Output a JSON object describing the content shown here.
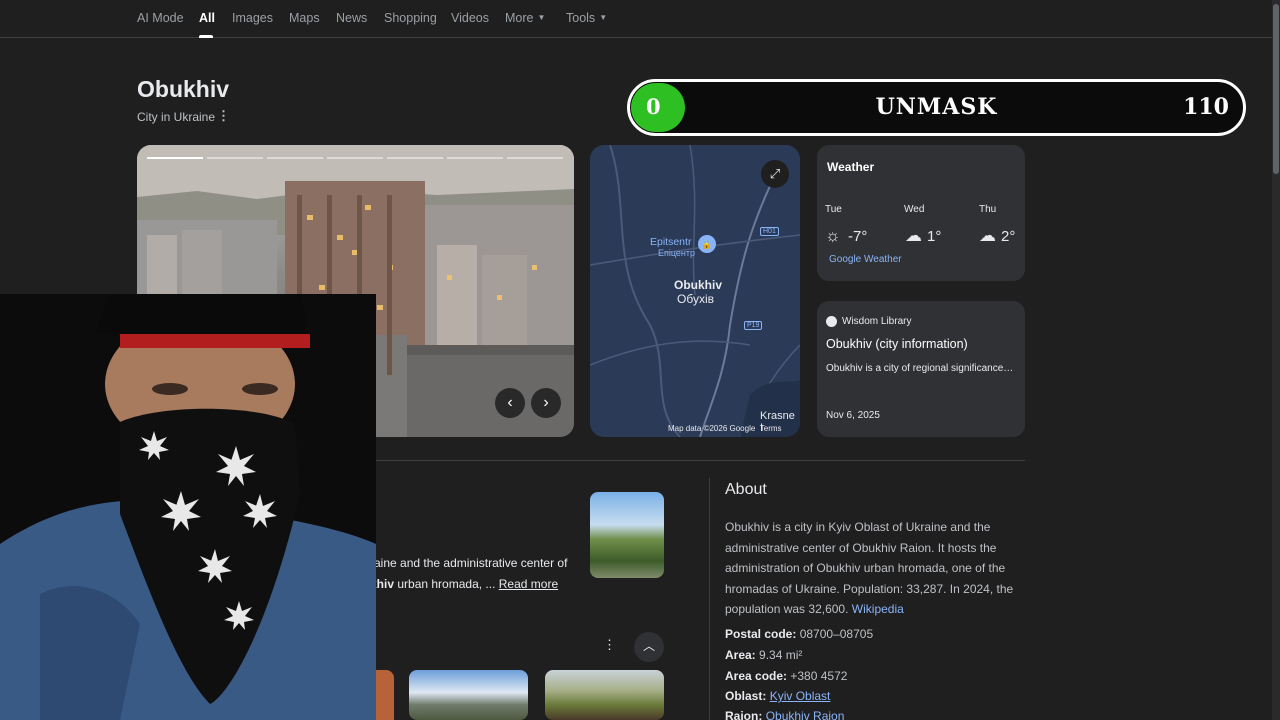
{
  "nav": {
    "tabs": [
      {
        "label": "AI Mode"
      },
      {
        "label": "All"
      },
      {
        "label": "Images"
      },
      {
        "label": "Maps"
      },
      {
        "label": "News"
      },
      {
        "label": "Shopping"
      },
      {
        "label": "Videos"
      },
      {
        "label": "More"
      },
      {
        "label": "Tools"
      }
    ],
    "active_tab": "All"
  },
  "entity": {
    "title": "Obukhiv",
    "subtitle": "City in Ukraine"
  },
  "overlay": {
    "label": "UNMASK",
    "current": "0",
    "max": "110",
    "progress_fraction": 0.0,
    "fill_color": "#2ec022"
  },
  "map": {
    "place_en": "Epitsentr",
    "place_uk": "Епіцентр",
    "city_en": "Obukhiv",
    "city_uk": "Обухів",
    "road_1": "H01",
    "road_2": "P19",
    "edge_label": "Krasne I",
    "attribution": "Map data ©2026 Google",
    "terms": "Terms"
  },
  "weather": {
    "title": "Weather",
    "days": [
      {
        "day": "Tue",
        "temp": "-7°",
        "icon": "sun-icon"
      },
      {
        "day": "Wed",
        "temp": "1°",
        "icon": "cloud-icon"
      },
      {
        "day": "Thu",
        "temp": "2°",
        "icon": "cloud-icon"
      }
    ],
    "source_link": "Google Weather"
  },
  "wisdom": {
    "source": "Wisdom Library",
    "title": "Obukhiv (city information)",
    "snippet": "Obukhiv is a city of regional significance…",
    "date": "Nov 6, 2025"
  },
  "overview": {
    "line1": "raine and the administrative center of",
    "line2_prefix": "khiv",
    "line2_rest": " urban hromada, ... ",
    "read_more": "Read more"
  },
  "about": {
    "heading": "About",
    "text": "Obukhiv is a city in Kyiv Oblast of Ukraine and the administrative center of Obukhiv Raion. It hosts the administration of Obukhiv urban hromada, one of the hromadas of Ukraine. Population: 33,287. In 2024, the population was 32,600.",
    "wiki_link": "Wikipedia",
    "facts": [
      {
        "label": "Postal code:",
        "value": "08700–08705",
        "link": false
      },
      {
        "label": "Area:",
        "value": "9.34 mi²",
        "link": false
      },
      {
        "label": "Area code:",
        "value": "+380 4572",
        "link": false
      },
      {
        "label": "Oblast:",
        "value": "Kyiv Oblast",
        "link": true
      },
      {
        "label": "Raion:",
        "value": "Obukhiv Raion",
        "link": true
      }
    ]
  },
  "colors": {
    "background": "#1f1f1f",
    "card": "#303134",
    "link": "#8ab4f8",
    "map_water": "#2a3a57"
  }
}
